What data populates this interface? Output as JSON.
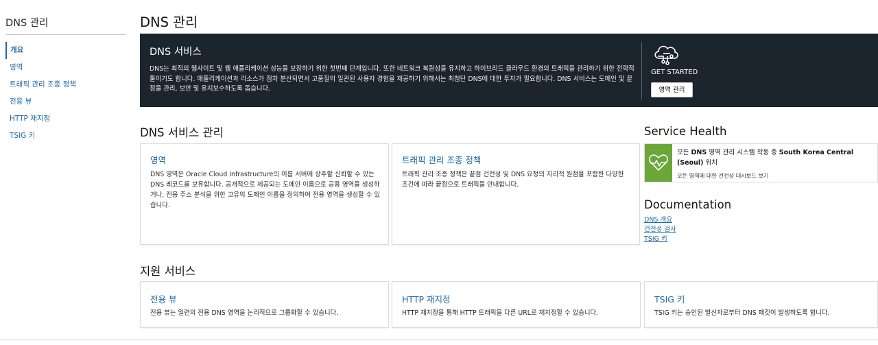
{
  "sidebar": {
    "title": "DNS 관리",
    "items": [
      {
        "label": "개요"
      },
      {
        "label": "영역"
      },
      {
        "label": "트래픽 관리 조종 정책"
      },
      {
        "label": "전용 뷰"
      },
      {
        "label": "HTTP 재지정"
      },
      {
        "label": "TSIG 키"
      }
    ]
  },
  "page": {
    "title": "DNS 관리"
  },
  "hero": {
    "title": "DNS 서비스",
    "description": "DNS는 최적의 웹사이트 및 웹 애플리케이션 성능을 보장하기 위한 첫번째 단계입니다. 또한 네트워크 복원성을 유지하고 하이브리드 클라우드 환경의 트래픽을 관리하기 위한 전략적 툴이기도 합니다. 애플리케이션과 리소스가 점차 분산되면서 고품질의 일관된 사용자 경험을 제공하기 위해서는 최첨단 DNS에 대한 투자가 필요합니다. DNS 서비스는 도메인 및 끝점을 관리, 보안 및 유지보수하도록 돕습니다.",
    "get_started": "GET STARTED",
    "button_label": "영역 관리",
    "icon": "cloud-network-icon"
  },
  "manage": {
    "title": "DNS 서비스 관리",
    "cards": [
      {
        "title": "영역",
        "text": "DNS 영역은 Oracle Cloud Infrastructure의 이름 서버에 상주할 신뢰할 수 있는 DNS 레코드를 보유합니다. 공개적으로 제공되는 도메인 이름으로 공용 영역을 생성하거나, 전용 주소 분석을 위한 고유의 도메인 이름을 정의하여 전용 영역을 생성할 수 있습니다."
      },
      {
        "title": "트래픽 관리 조종 정책",
        "text": "트래픽 관리 조종 정책은 끝점 건전성 및 DNS 요청의 지리적 원점을 포함한 다양한 조건에 따라 끝점으로 트래픽을 안내합니다."
      }
    ]
  },
  "health": {
    "title": "Service Health",
    "prefix": "모든",
    "bold1": "DNS",
    "middle": "영역 관리 시스템 작동 중",
    "bold2": "South Korea Central (Seoul)",
    "suffix": "위치",
    "sub": "모든 영역에 대한 건전성 대시보드 보기",
    "icon": "heart-pulse-icon",
    "status_color": "#6aa638"
  },
  "docs": {
    "title": "Documentation",
    "links": [
      {
        "label": "DNS 개요"
      },
      {
        "label": "건전성 검사"
      },
      {
        "label": "TSIG 키"
      }
    ]
  },
  "support": {
    "title": "지원 서비스",
    "cards": [
      {
        "title": "전용 뷰",
        "text": "전용 뷰는 일련의 전용 DNS 영역을 논리적으로 그룹화할 수 있습니다."
      },
      {
        "title": "HTTP 재지정",
        "text": "HTTP 재지정을 통해 HTTP 트래픽을 다른 URL로 재지정할 수 있습니다."
      },
      {
        "title": "TSIG 키",
        "text": "TSIG 키는 승인된 발신자로부터 DNS 패킷이 발생하도록 합니다."
      }
    ]
  }
}
